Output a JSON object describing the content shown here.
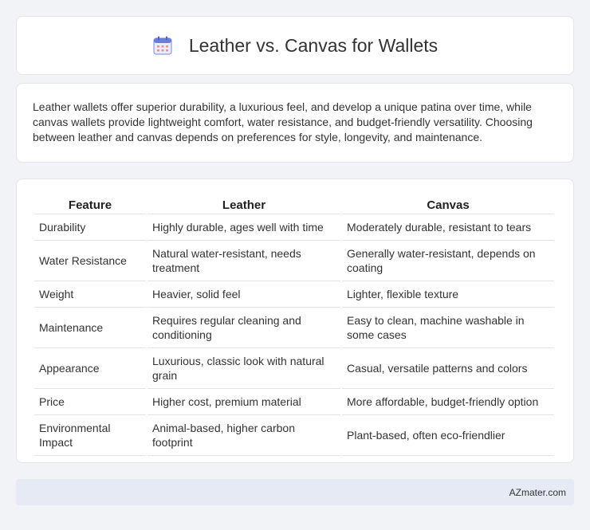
{
  "header": {
    "title": "Leather vs. Canvas for Wallets",
    "icon": "calendar-icon"
  },
  "summary": {
    "text": "Leather wallets offer superior durability, a luxurious feel, and develop a unique patina over time, while canvas wallets provide lightweight comfort, water resistance, and budget-friendly versatility. Choosing between leather and canvas depends on preferences for style, longevity, and maintenance."
  },
  "table": {
    "headers": [
      "Feature",
      "Leather",
      "Canvas"
    ],
    "rows": [
      [
        "Durability",
        "Highly durable, ages well with time",
        "Moderately durable, resistant to tears"
      ],
      [
        "Water Resistance",
        "Natural water-resistant, needs treatment",
        "Generally water-resistant, depends on coating"
      ],
      [
        "Weight",
        "Heavier, solid feel",
        "Lighter, flexible texture"
      ],
      [
        "Maintenance",
        "Requires regular cleaning and conditioning",
        "Easy to clean, machine washable in some cases"
      ],
      [
        "Appearance",
        "Luxurious, classic look with natural grain",
        "Casual, versatile patterns and colors"
      ],
      [
        "Price",
        "Higher cost, premium material",
        "More affordable, budget-friendly option"
      ],
      [
        "Environmental Impact",
        "Animal-based, higher carbon footprint",
        "Plant-based, often eco-friendlier"
      ]
    ]
  },
  "footer": {
    "site": "AZmater.com"
  },
  "colors": {
    "background": "#f1f3f7",
    "card": "#ffffff",
    "footer_bg": "#e5eaf4",
    "icon_accent": "#6b7fd6"
  }
}
